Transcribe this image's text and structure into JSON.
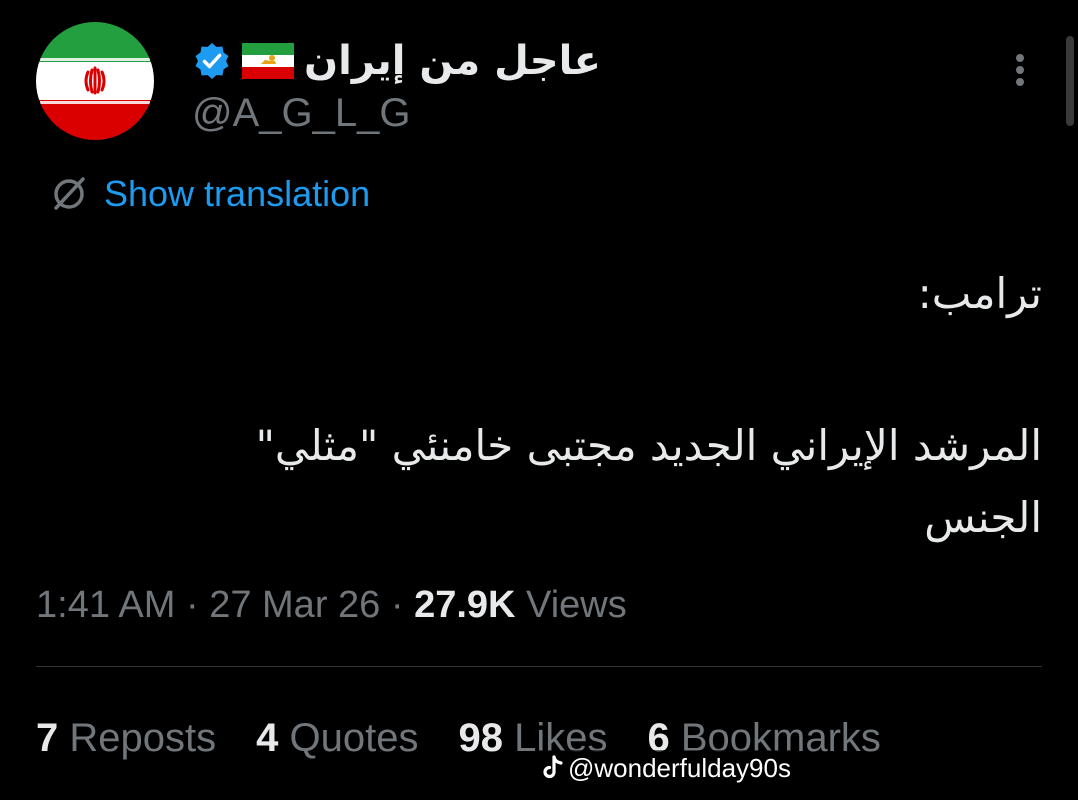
{
  "author": {
    "display_name": "عاجل من إيران",
    "handle": "@A_G_L_G",
    "verified": true,
    "flag_icon": "iran-lion-sun-flag-icon",
    "avatar_icon": "iran-flag-avatar"
  },
  "translation": {
    "label": "Show translation",
    "icon": "globe-slash-icon"
  },
  "tweet": {
    "line1": "ترامب:",
    "line2": "المرشد الإيراني الجديد مجتبى خامنئي \"مثلي\"",
    "line3": "الجنس"
  },
  "meta": {
    "time": "1:41 AM",
    "date": "27 Mar 26",
    "views_count": "27.9K",
    "views_label": "Views",
    "separator": "·"
  },
  "stats": {
    "reposts_count": "7",
    "reposts_label": "Reposts",
    "quotes_count": "4",
    "quotes_label": "Quotes",
    "likes_count": "98",
    "likes_label": "Likes",
    "bookmarks_count": "6",
    "bookmarks_label": "Bookmarks"
  },
  "watermark": {
    "text": "@wonderfulday90s",
    "icon": "tiktok-icon"
  },
  "colors": {
    "background": "#000000",
    "text_primary": "#e7e9ea",
    "text_secondary": "#71767b",
    "link": "#1d9bf0",
    "verified": "#1d9bf0",
    "divider": "#2f3336"
  }
}
